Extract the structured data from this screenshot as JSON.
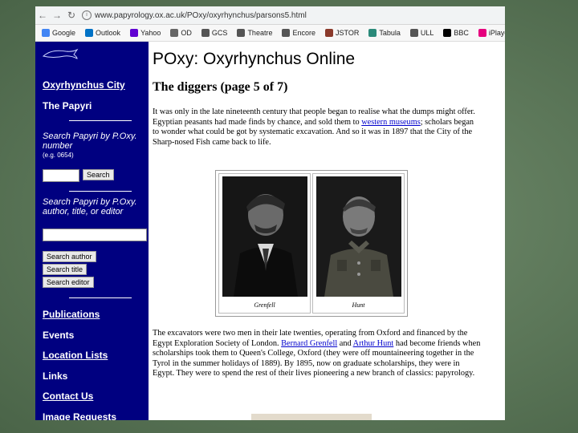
{
  "browser": {
    "url": "www.papyrology.ox.ac.uk/POxy/oxyrhynchus/parsons5.html",
    "bookmarks": [
      "Google",
      "Outlook",
      "Yahoo",
      "OD",
      "GCS",
      "Theatre",
      "Encore",
      "JSTOR",
      "Tabula",
      "ULL",
      "BBC",
      "iPlayer"
    ]
  },
  "sidebar": {
    "city_link": "Oxyrhynchus City",
    "papyri_link": "The Papyri",
    "search_number_label": "Search Papyri by P.Oxy. number",
    "search_number_hint": "(e.g. 0654)",
    "search_button": "Search",
    "search_author_label": "Search Papyri by P.Oxy. author, title, or editor",
    "btn_author": "Search author",
    "btn_title": "Search title",
    "btn_editor": "Search editor",
    "links": [
      "Publications",
      "Events",
      "Location Lists",
      "Links",
      "Contact Us",
      "Image Requests"
    ]
  },
  "main": {
    "title": "POxy: Oxyrhynchus Online",
    "subtitle": "The diggers (page 5 of 7)",
    "p1_a": "It was only in the late nineteenth century that people began to realise what the dumps might offer. Egyptian peasants had made finds by chance, and sold them to ",
    "p1_link": "western museums",
    "p1_b": "; scholars began to wonder what could be got by systematic excavation. And so it was in 1897 that the City of the Sharp-nosed Fish came back to life.",
    "caption_left": "Grenfell",
    "caption_right": "Hunt",
    "p2_a": "The excavators were two men in their late twenties, operating from Oxford and financed by the Egypt Exploration Society of London. ",
    "p2_link1": "Bernard Grenfell",
    "p2_and": " and ",
    "p2_link2": "Arthur Hunt",
    "p2_b": " had become friends when scholarships took them to Queen's College, Oxford (they were off mountaineering together in the Tyrol in the summer holidays of 1889). By 1895, now on graduate scholarships, they were in Egypt. They were to spend the rest of their lives pioneering a new branch of classics: papyrology."
  }
}
